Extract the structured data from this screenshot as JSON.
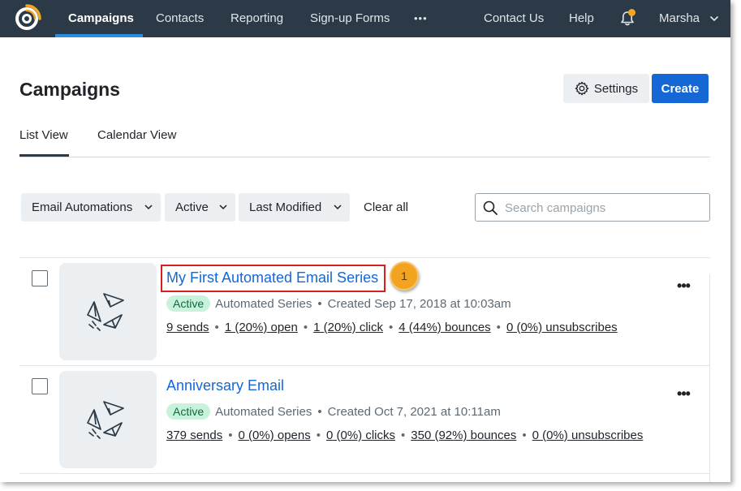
{
  "nav": {
    "items": [
      "Campaigns",
      "Contacts",
      "Reporting",
      "Sign-up Forms",
      "•••",
      "Contact Us",
      "Help"
    ],
    "user": "Marsha"
  },
  "header": {
    "title": "Campaigns",
    "settings_label": "Settings",
    "create_label": "Create"
  },
  "tabs": [
    "List View",
    "Calendar View"
  ],
  "filters": {
    "type": "Email Automations",
    "status": "Active",
    "sort": "Last Modified",
    "clear_label": "Clear all",
    "search_placeholder": "Search campaigns"
  },
  "campaigns": [
    {
      "name": "My First Automated Email Series",
      "status": "Active",
      "kind": "Automated Series",
      "created": "Created Sep 17, 2018 at 10:03am",
      "stats": [
        "9 sends",
        "1 (20%) open",
        "1 (20%) click",
        "4 (44%) bounces",
        "0 (0%) unsubscribes"
      ]
    },
    {
      "name": "Anniversary Email",
      "status": "Active",
      "kind": "Automated Series",
      "created": "Created Oct 7, 2021 at 10:11am",
      "stats": [
        "379 sends",
        "0 (0%) opens",
        "0 (0%) clicks",
        "350 (92%) bounces",
        "0 (0%) unsubscribes"
      ]
    }
  ],
  "callout": "1",
  "colors": {
    "nav_bg": "#2b3a46",
    "primary": "#1467d4",
    "active_badge_bg": "#c9f2dc",
    "callout": "#f2a31f",
    "highlight_border": "#d61f1f"
  }
}
